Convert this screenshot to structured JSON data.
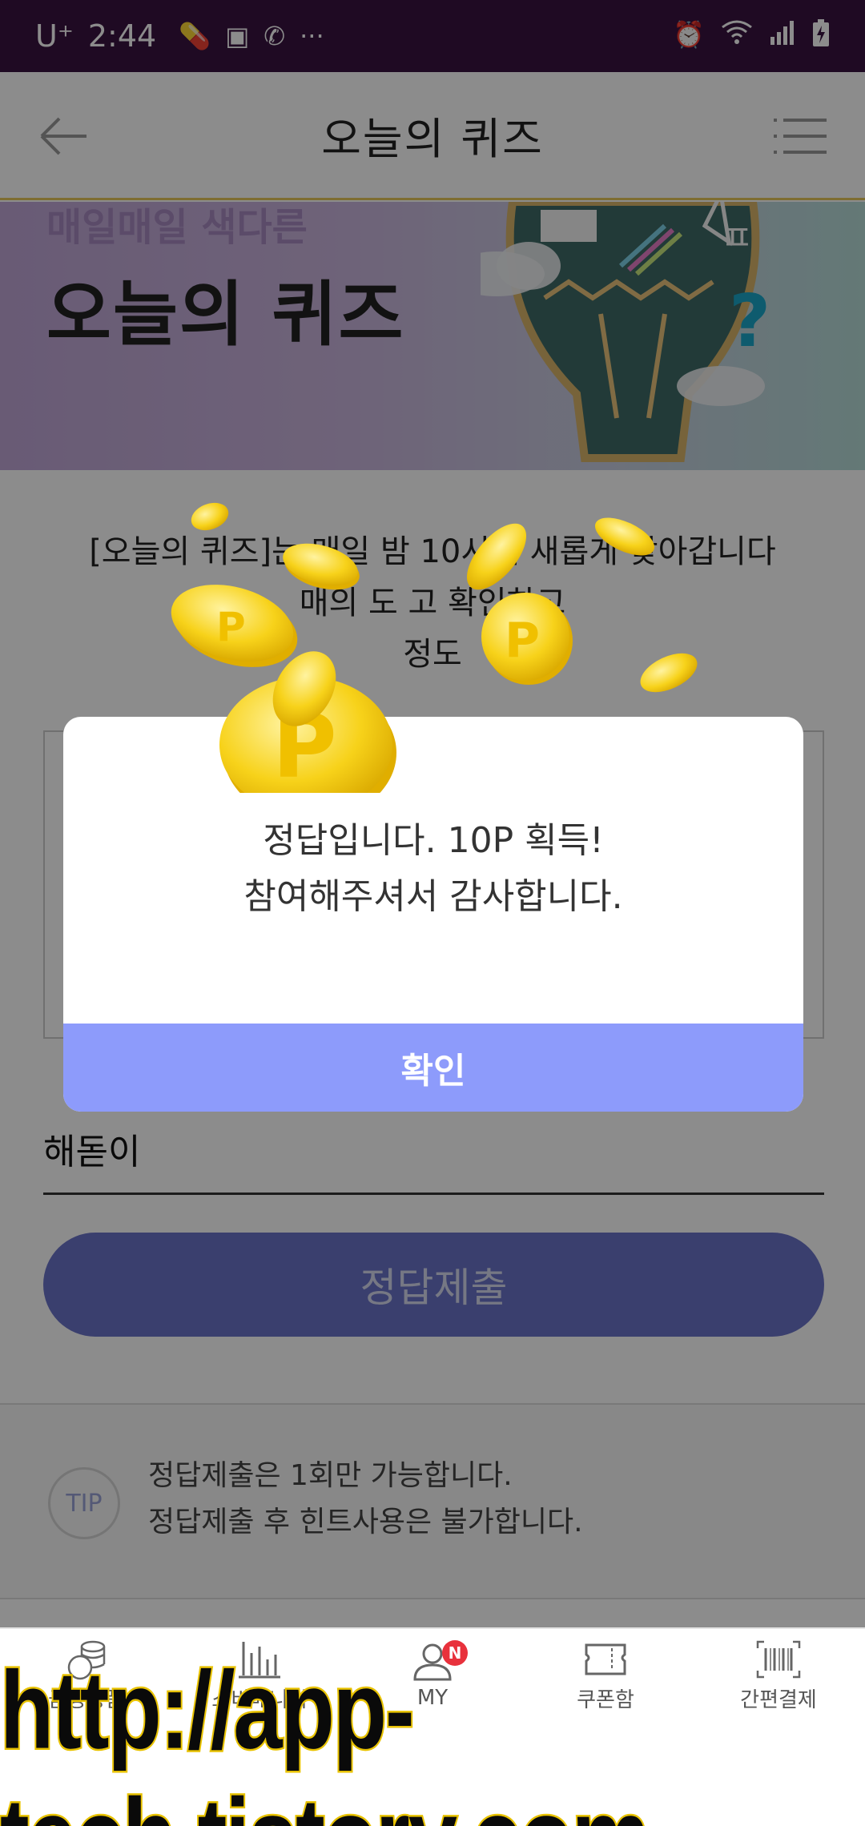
{
  "status_bar": {
    "carrier": "U⁺",
    "time": "2:44",
    "left_icons": [
      "pill-icon",
      "image-icon",
      "call-icon",
      "more-icon"
    ],
    "right_icons": [
      "alarm-icon",
      "wifi-icon",
      "signal-icon",
      "battery-icon"
    ]
  },
  "header": {
    "title": "오늘의 퀴즈",
    "back_icon": "arrow-left-icon",
    "menu_icon": "hamburger-menu-icon"
  },
  "banner": {
    "subtitle": "매일매일 색다른",
    "title": "오늘의 퀴즈"
  },
  "intro": {
    "lines": [
      "[오늘의 퀴즈]는 매일 밤 10시에 새롭게 찾아갑니다",
      "매의 도 고 확인하고",
      "정도"
    ]
  },
  "answer": {
    "value": "해돋이"
  },
  "submit": {
    "label": "정답제출"
  },
  "tip": {
    "badge": "TIP",
    "line1": "정답제출은 1회만 가능합니다.",
    "line2": "정답제출 후 힌트사용은 불가합니다."
  },
  "modal": {
    "line1": "정답입니다. 10P 획득!",
    "line2": "참여해주셔서 감사합니다.",
    "confirm_label": "확인",
    "confirm_color": "#8d9bfb"
  },
  "bottom_nav": {
    "items": [
      {
        "label": "금융상품",
        "icon": "coins-stack-icon"
      },
      {
        "label": "소비매니저",
        "icon": "bar-chart-icon"
      },
      {
        "label": "MY",
        "icon": "user-icon",
        "badge": "N"
      },
      {
        "label": "쿠폰함",
        "icon": "ticket-icon"
      },
      {
        "label": "간편결제",
        "icon": "barcode-icon"
      }
    ]
  },
  "watermark": {
    "text": "http://app-tech.tistory.com"
  },
  "colors": {
    "status_bar": "#3a1340",
    "accent": "#8d9bfb",
    "submit_button": "#6b73c9",
    "coin": "#f7d21a"
  }
}
